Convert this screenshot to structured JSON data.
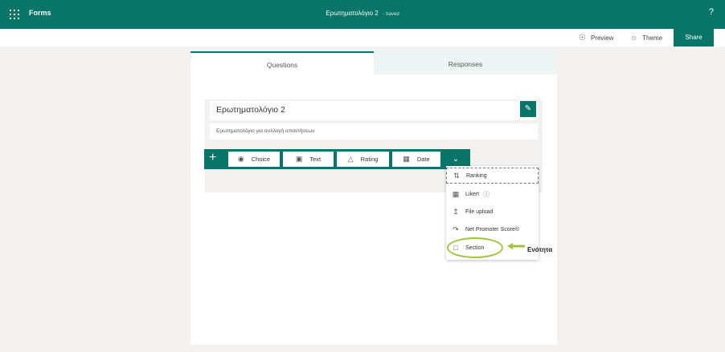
{
  "app": {
    "name": "Forms"
  },
  "header": {
    "doc_title": "Ερωτηματολόγιο 2",
    "status": "Saved",
    "help": "?"
  },
  "commandbar": {
    "preview": "Preview",
    "theme": "Theme",
    "share": "Share"
  },
  "tabs": [
    {
      "label": "Questions",
      "active": true
    },
    {
      "label": "Responses",
      "active": false
    }
  ],
  "form": {
    "title": "Ερωτηματολόγιο 2",
    "subtitle": "Ερωτηματολόγιο για συλλογή απαντήσεων"
  },
  "question_types": {
    "add": "+",
    "choice": "Choice",
    "text": "Text",
    "rating": "Rating",
    "date": "Date",
    "more": "⌄"
  },
  "more_menu": {
    "ranking": "Ranking",
    "likert": "Likert",
    "file_upload": "File upload",
    "nps": "Net Promoter Score®",
    "section": "Section"
  },
  "annotation": {
    "label": "Ενότητα",
    "color": "#a2c43d"
  },
  "colors": {
    "accent": "#077568",
    "page_bg": "#f3f2f1"
  }
}
